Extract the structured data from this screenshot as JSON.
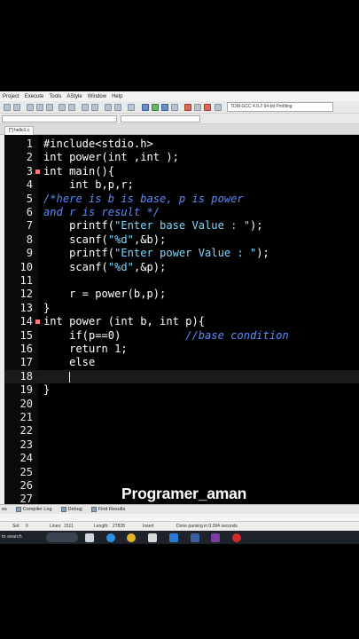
{
  "menu": [
    "Project",
    "Execute",
    "Tools",
    "AStyle",
    "Window",
    "Help"
  ],
  "toolbar": {
    "compiler": "TDM-GCC 4.9.2 64-bit Profiling"
  },
  "file_tab": "[*] hello1.c",
  "code_lines": [
    {
      "n": "1",
      "fold": false,
      "parts": [
        {
          "t": "#include<stdio.h>",
          "c": "plain"
        }
      ]
    },
    {
      "n": "2",
      "fold": false,
      "parts": [
        {
          "t": "int power(int ,int );",
          "c": "plain"
        }
      ]
    },
    {
      "n": "3",
      "fold": true,
      "parts": [
        {
          "t": "int main(){",
          "c": "plain"
        }
      ]
    },
    {
      "n": "4",
      "fold": false,
      "parts": [
        {
          "t": "    int b,p,r;",
          "c": "plain"
        }
      ]
    },
    {
      "n": "5",
      "fold": false,
      "parts": [
        {
          "t": "/*here is b is base, p is power",
          "c": "cmt"
        }
      ]
    },
    {
      "n": "6",
      "fold": false,
      "parts": [
        {
          "t": "and r is result */",
          "c": "cmt"
        }
      ]
    },
    {
      "n": "7",
      "fold": false,
      "parts": [
        {
          "t": "    printf(",
          "c": "plain"
        },
        {
          "t": "\"Enter base Value : \"",
          "c": "str"
        },
        {
          "t": ");",
          "c": "plain"
        }
      ]
    },
    {
      "n": "8",
      "fold": false,
      "parts": [
        {
          "t": "    scanf(",
          "c": "plain"
        },
        {
          "t": "\"%d\"",
          "c": "str"
        },
        {
          "t": ",&b);",
          "c": "plain"
        }
      ]
    },
    {
      "n": "9",
      "fold": false,
      "parts": [
        {
          "t": "    printf(",
          "c": "plain"
        },
        {
          "t": "\"Enter power Value : \"",
          "c": "str"
        },
        {
          "t": ");",
          "c": "plain"
        }
      ]
    },
    {
      "n": "10",
      "fold": false,
      "parts": [
        {
          "t": "    scanf(",
          "c": "plain"
        },
        {
          "t": "\"%d\"",
          "c": "str"
        },
        {
          "t": ",&p);",
          "c": "plain"
        }
      ]
    },
    {
      "n": "11",
      "fold": false,
      "parts": []
    },
    {
      "n": "12",
      "fold": false,
      "parts": [
        {
          "t": "    r = power(b,p);",
          "c": "plain"
        }
      ]
    },
    {
      "n": "13",
      "fold": false,
      "parts": [
        {
          "t": "}",
          "c": "plain"
        }
      ]
    },
    {
      "n": "14",
      "fold": true,
      "parts": [
        {
          "t": "int power (int b, int p){",
          "c": "plain"
        }
      ]
    },
    {
      "n": "15",
      "fold": false,
      "parts": [
        {
          "t": "    if(p==0)          ",
          "c": "plain"
        },
        {
          "t": "//base condition",
          "c": "cmt"
        }
      ]
    },
    {
      "n": "16",
      "fold": false,
      "parts": [
        {
          "t": "    return 1;",
          "c": "plain"
        }
      ]
    },
    {
      "n": "17",
      "fold": false,
      "parts": [
        {
          "t": "    else",
          "c": "plain"
        }
      ]
    },
    {
      "n": "18",
      "fold": false,
      "parts": [],
      "active": true
    },
    {
      "n": "19",
      "fold": false,
      "parts": [
        {
          "t": "}",
          "c": "plain"
        }
      ]
    },
    {
      "n": "20",
      "fold": false,
      "parts": []
    },
    {
      "n": "21",
      "fold": false,
      "parts": []
    },
    {
      "n": "22",
      "fold": false,
      "parts": []
    },
    {
      "n": "23",
      "fold": false,
      "parts": []
    },
    {
      "n": "24",
      "fold": false,
      "parts": []
    },
    {
      "n": "25",
      "fold": false,
      "parts": []
    },
    {
      "n": "26",
      "fold": false,
      "parts": []
    },
    {
      "n": "27",
      "fold": false,
      "parts": []
    }
  ],
  "watermark": "Programer_aman",
  "bottom_tabs": [
    "Compiler Log",
    "Debug",
    "Find Results"
  ],
  "bottom_tab_partial": "es",
  "status": {
    "sel": "Sel:",
    "sel_val": "0",
    "lines": "Lines:",
    "lines_val": "1511",
    "length": "Length:",
    "length_val": "27828",
    "mode": "Insert",
    "message": "Done parsing in 0.394 seconds"
  },
  "taskbar": {
    "search": "to search"
  },
  "colors": {
    "editor_bg": "#000000",
    "string": "#7edaff",
    "comment": "#5a8cff",
    "fold_marker": "#ff7b7b"
  }
}
